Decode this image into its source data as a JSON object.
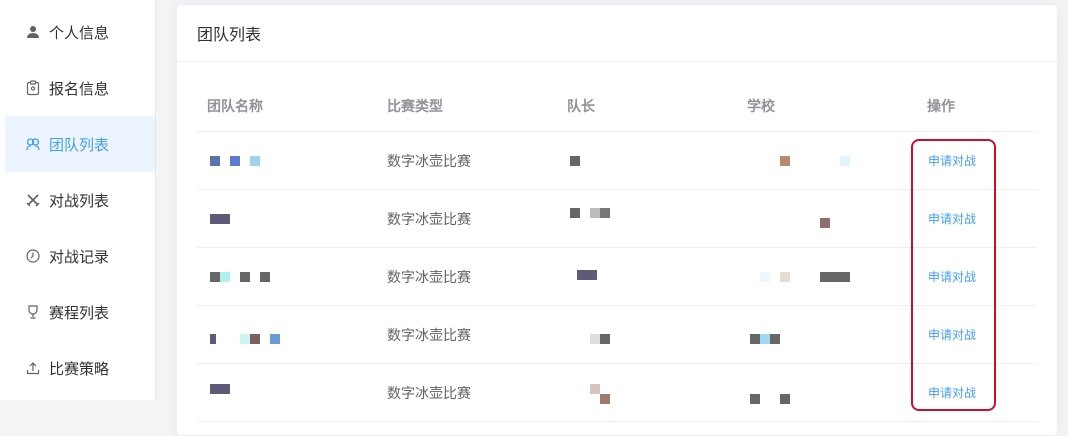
{
  "sidebar": {
    "items": [
      {
        "label": "个人信息",
        "icon": "user-icon",
        "active": false
      },
      {
        "label": "报名信息",
        "icon": "clipboard-icon",
        "active": false
      },
      {
        "label": "团队列表",
        "icon": "team-icon",
        "active": true
      },
      {
        "label": "对战列表",
        "icon": "crossed-swords-icon",
        "active": false
      },
      {
        "label": "对战记录",
        "icon": "clock-icon",
        "active": false
      },
      {
        "label": "赛程列表",
        "icon": "trophy-icon",
        "active": false
      },
      {
        "label": "比赛策略",
        "icon": "upload-icon",
        "active": false
      }
    ]
  },
  "card": {
    "title": "团队列表",
    "columns": [
      "团队名称",
      "比赛类型",
      "队长",
      "学校",
      "操作"
    ],
    "rows": [
      {
        "team": "",
        "type": "数字冰壶比赛",
        "captain": "",
        "school": "",
        "action": "申请对战"
      },
      {
        "team": "",
        "type": "数字冰壶比赛",
        "captain": "",
        "school": "",
        "action": "申请对战"
      },
      {
        "team": "",
        "type": "数字冰壶比赛",
        "captain": "",
        "school": "",
        "action": "申请对战"
      },
      {
        "team": "",
        "type": "数字冰壶比赛",
        "captain": "",
        "school": "",
        "action": "申请对战"
      },
      {
        "team": "",
        "type": "数字冰壶比赛",
        "captain": "",
        "school": "",
        "action": "申请对战"
      }
    ]
  },
  "colors": {
    "accent": "#409eff",
    "active_bg": "#ecf5ff",
    "highlight_box": "#c8102e"
  }
}
